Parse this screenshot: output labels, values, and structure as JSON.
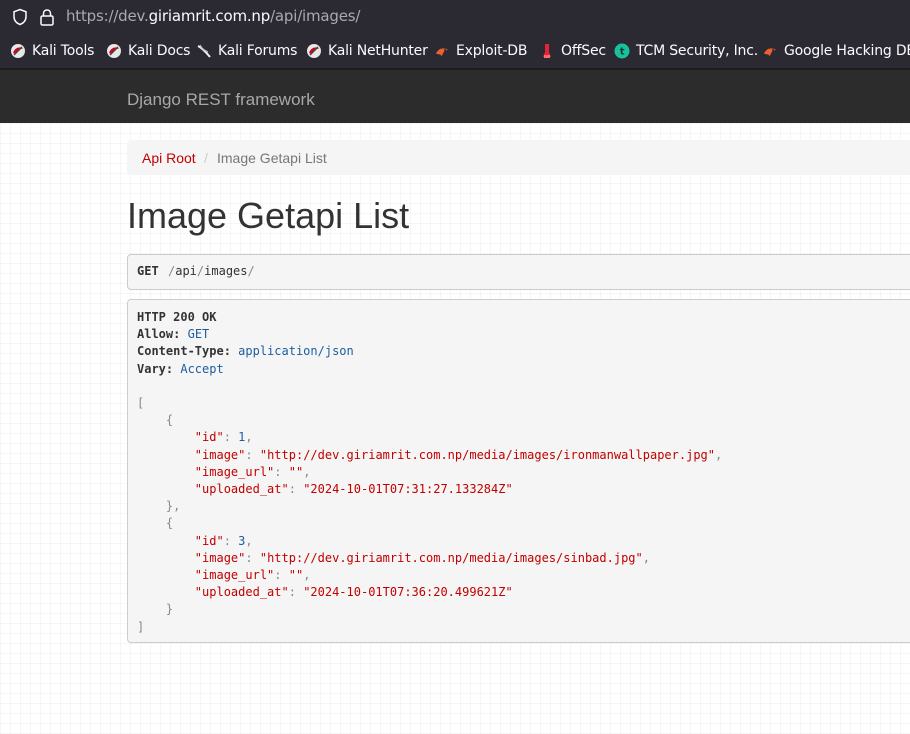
{
  "browser": {
    "url_prefix": "https://dev.",
    "url_host": "giriamrit.com.np",
    "url_path": "/api/images/",
    "bookmarks": [
      {
        "label": "Kali Tools",
        "icon": "kali-dragon-icon"
      },
      {
        "label": "Kali Docs",
        "icon": "kali-dragon-icon"
      },
      {
        "label": "Kali Forums",
        "icon": "kali-forums-icon"
      },
      {
        "label": "Kali NetHunter",
        "icon": "kali-dragon-icon"
      },
      {
        "label": "Exploit-DB",
        "icon": "exploit-db-icon"
      },
      {
        "label": "OffSec",
        "icon": "offsec-icon"
      },
      {
        "label": "TCM Security, Inc.",
        "icon": "tcm-icon"
      },
      {
        "label": "Google Hacking DB",
        "icon": "exploit-db-icon"
      }
    ]
  },
  "navbar": {
    "brand": "Django REST framework"
  },
  "breadcrumb": {
    "root": "Api Root",
    "separator": "/",
    "current": "Image Getapi List"
  },
  "page": {
    "title": "Image Getapi List"
  },
  "request": {
    "method": "GET",
    "path_parts": [
      "api",
      "images"
    ]
  },
  "response": {
    "status": "HTTP 200 OK",
    "headers": [
      {
        "name": "Allow:",
        "value": "GET"
      },
      {
        "name": "Content-Type:",
        "value": "application/json"
      },
      {
        "name": "Vary:",
        "value": "Accept"
      }
    ],
    "items": [
      {
        "id": "1",
        "image": "\"http://dev.giriamrit.com.np/media/images/ironmanwallpaper.jpg\"",
        "image_url": "\"\"",
        "uploaded_at": "\"2024-10-01T07:31:27.133284Z\""
      },
      {
        "id": "3",
        "image": "\"http://dev.giriamrit.com.np/media/images/sinbad.jpg\"",
        "image_url": "\"\"",
        "uploaded_at": "\"2024-10-01T07:36:20.499621Z\""
      }
    ],
    "keys": {
      "id": "\"id\"",
      "image": "\"image\"",
      "image_url": "\"image_url\"",
      "uploaded_at": "\"uploaded_at\""
    }
  },
  "colors": {
    "accent": "#c20000",
    "navbar": "#2c2c2c",
    "header_value": "#1d5ea1"
  }
}
